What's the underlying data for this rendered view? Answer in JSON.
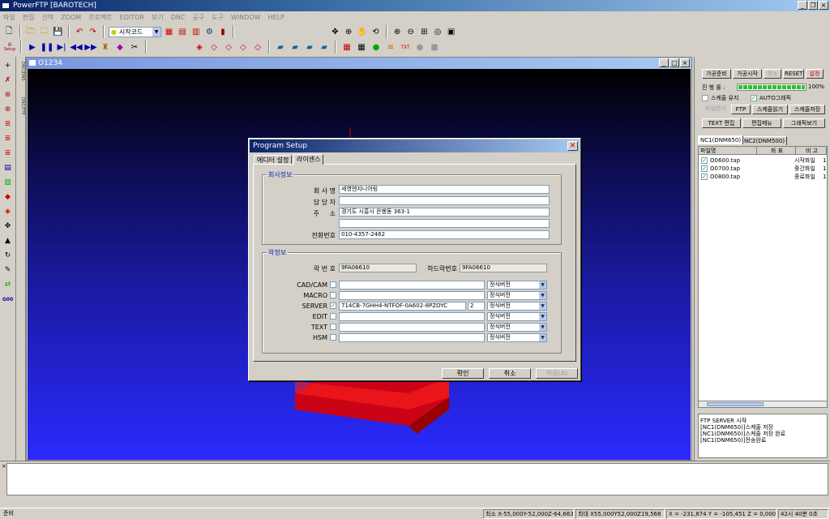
{
  "app": {
    "title": "PowerFTP [BAROTECH]"
  },
  "menu": [
    "파일",
    "편집",
    "선택",
    "ZOOM",
    "프로젝트",
    "EDITOR",
    "보기",
    "DNC",
    "공구",
    "도구",
    "WINDOW",
    "HELP"
  ],
  "toolbar": {
    "start_code": "시작코드",
    "setup_label": "Setup"
  },
  "document": {
    "title": "O1234"
  },
  "left_strip": [
    "DNC/DNS",
    "DNC/FTP"
  ],
  "dialog": {
    "title": "Program Setup",
    "tabs": [
      "에디터 설정",
      "라이센스"
    ],
    "company_group": "회사정보",
    "company_labels": {
      "name": "회 사 명",
      "manager": "담 당 자",
      "address": "주     소",
      "phone": "전화번호"
    },
    "company_values": {
      "name": "세영엔지니어링",
      "manager": "",
      "address": "경기도 시흥시 은행동 363-1",
      "address2": "",
      "phone": "010-4357-2462"
    },
    "lock_group": "락정보",
    "lock_labels": {
      "lock_no": "락 번 호",
      "hard_lock_no": "하드락번호"
    },
    "lock_values": {
      "lock_no": "9FA06610",
      "hard_lock_no": "9FA06610"
    },
    "modules": [
      {
        "name": "CAD/CAM",
        "checked": false,
        "key": "",
        "count": "",
        "version": "정식버전"
      },
      {
        "name": "MACRO",
        "checked": false,
        "key": "",
        "count": "",
        "version": "정식버전"
      },
      {
        "name": "SERVER",
        "checked": true,
        "key": "714CB-7GHH4-NTFOF-0A602-8PZOYC",
        "count": "2",
        "version": "정식버전"
      },
      {
        "name": "EDIT",
        "checked": false,
        "key": "",
        "count": "",
        "version": "정식버전"
      },
      {
        "name": "TEXT",
        "checked": false,
        "key": "",
        "count": "",
        "version": "정식버전"
      },
      {
        "name": "HSM",
        "checked": false,
        "key": "",
        "count": "",
        "version": "정식버전"
      }
    ],
    "buttons": {
      "ok": "확인",
      "cancel": "취소",
      "apply": "적용(A)"
    }
  },
  "panel": {
    "buttons_row1": [
      "가공준비",
      "가공시작",
      "취소",
      "RESET",
      "설정"
    ],
    "progress_label": "진 행 률 :",
    "progress_value": "100%",
    "progress_fraction": 1.0,
    "check_schedule": "스케줄 유지",
    "check_auto": "AUTO그래픽",
    "buttons_row3": [
      "파일받기",
      "FTP",
      "스케줄읽기",
      "스케줄저장"
    ],
    "buttons_row4": [
      "TEXT 편집",
      "편집메뉴",
      "그래픽보기"
    ],
    "tabs": [
      "NC1(DNM650)",
      "NC2(DNM500)"
    ],
    "list_headers": [
      "파일명",
      "좌 표",
      "비 고"
    ],
    "files": [
      {
        "name": "O0600.tap",
        "note": "시작화일",
        "extra": "1"
      },
      {
        "name": "O0700.tap",
        "note": "중간화일",
        "extra": "1"
      },
      {
        "name": "O0800.tap",
        "note": "종료화일",
        "extra": "1"
      }
    ],
    "log": [
      "FTP SERVER 시작",
      "[NC1(DNM650)]스케줄 저장",
      "[NC1(DNM650)]스케줄 저장 완료",
      "[NC1(DNM650)]전송완료"
    ]
  },
  "status": {
    "ready": "준비",
    "min": "최소 X-55,000Y-52,000Z-64,663",
    "max": "최대 X55,000Y52,000Z19,568",
    "coords": "X = -231,874  Y = -105,451  Z = 0,000",
    "time": "42시 40분 0초"
  },
  "colors": {
    "title_blue": "#0a246a",
    "viewport_top": "#000000",
    "viewport_bottom": "#2a2aff",
    "part_red": "#dd0000"
  }
}
